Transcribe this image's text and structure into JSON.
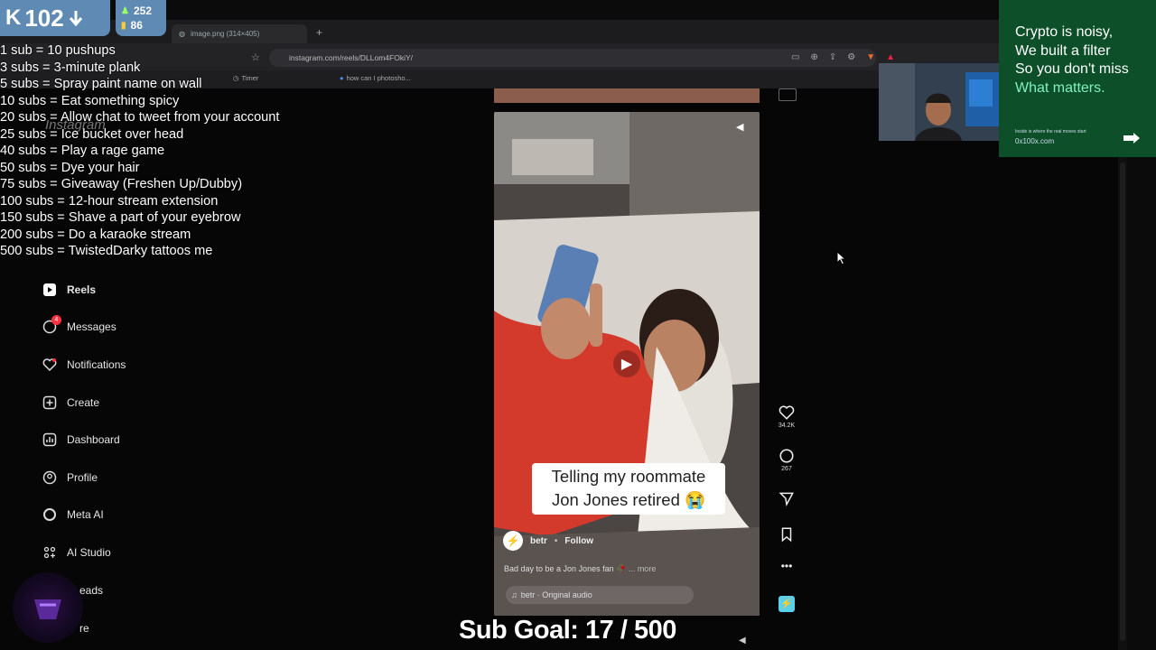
{
  "kick": {
    "number": "102",
    "stat_followers": "252",
    "stat_viewers": "86"
  },
  "browser": {
    "tab_title": "image.png (314×405)",
    "new_tab": "+",
    "url": "instagram.com/reels/DLLom4FOkiY/",
    "bookmarks": [
      {
        "label": "Timer"
      },
      {
        "label": "how can I photosho..."
      }
    ]
  },
  "rules": [
    "1 sub = 10 pushups",
    "3 subs = 3-minute plank",
    "5 subs = Spray paint name on wall",
    "10 subs = Eat something spicy",
    "20 subs = Allow chat to tweet from your account",
    "25 subs = Ice bucket over head",
    "40 subs = Play a rage game",
    "50 subs = Dye your hair",
    "75 subs = Giveaway (Freshen Up/Dubby)",
    "100 subs = 12-hour stream extension",
    "150 subs = Shave a part of your eyebrow",
    "200 subs = Do a karaoke stream",
    "500 subs = TwistedDarky tattoos me"
  ],
  "sidebar": {
    "logo": "Instagram",
    "items": [
      {
        "label": "Reels",
        "icon": "reels-icon"
      },
      {
        "label": "Messages",
        "icon": "messages-icon",
        "badge": "4"
      },
      {
        "label": "Notifications",
        "icon": "heart-icon"
      },
      {
        "label": "Create",
        "icon": "plus-square-icon"
      },
      {
        "label": "Dashboard",
        "icon": "dashboard-icon"
      },
      {
        "label": "Profile",
        "icon": "profile-icon"
      },
      {
        "label": "Meta AI",
        "icon": "meta-ai-icon"
      },
      {
        "label": "AI Studio",
        "icon": "ai-studio-icon"
      },
      {
        "label": "eads",
        "icon": "threads-icon"
      },
      {
        "label": "re",
        "icon": "more-icon"
      }
    ]
  },
  "reel": {
    "caption_line1": "Telling my roommate",
    "caption_line2": "Jon Jones retired 😭",
    "username": "betr",
    "follow": "Follow",
    "description": "Bad day to be a Jon Jones fan 🥀",
    "more": "... more",
    "audio": "betr · Original audio",
    "likes": "34.2K",
    "comments": "267"
  },
  "sub_goal": {
    "label": "Sub Goal:",
    "current": "17",
    "separator": "/",
    "target": "500",
    "progress": 0.034
  },
  "ad": {
    "line1": "Crypto is noisy,",
    "line2": "We built a filter",
    "line3": "So you don't miss",
    "line4": "What matters.",
    "small": "Inside is where the real moves start",
    "url": "0x100x.com",
    "accent": "#7ff0c0"
  },
  "colors": {
    "kick_badge": "#5f8ab3",
    "ad_bg": "#0d4f28",
    "reel_shirt": "#d33a2c"
  }
}
